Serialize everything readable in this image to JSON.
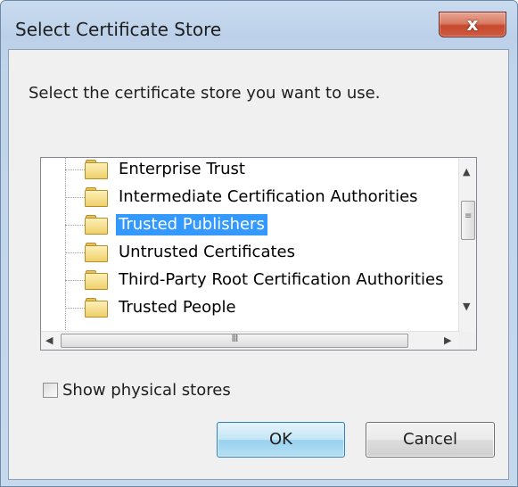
{
  "window": {
    "title": "Select Certificate Store",
    "close_glyph": "x"
  },
  "prompt": "Select the certificate store you want to use.",
  "tree": {
    "items": [
      {
        "label": "Enterprise Trust",
        "icon": "folder-icon",
        "selected": false
      },
      {
        "label": "Intermediate Certification Authorities",
        "icon": "folder-icon",
        "selected": false
      },
      {
        "label": "Trusted Publishers",
        "icon": "folder-icon",
        "selected": true
      },
      {
        "label": "Untrusted Certificates",
        "icon": "folder-icon",
        "selected": false
      },
      {
        "label": "Third-Party Root Certification Authorities",
        "icon": "folder-icon",
        "selected": false
      },
      {
        "label": "Trusted People",
        "icon": "folder-icon",
        "selected": false
      }
    ],
    "scroll_up_glyph": "▲",
    "scroll_down_glyph": "▼",
    "scroll_left_glyph": "◀",
    "scroll_right_glyph": "▶",
    "vthumb_grip": "≡",
    "hthumb_grip": "III"
  },
  "show_physical": {
    "label": "Show physical stores",
    "checked": false
  },
  "buttons": {
    "ok": "OK",
    "cancel": "Cancel"
  },
  "colors": {
    "selection": "#3399ff",
    "ok_border": "#3c7fb1",
    "close_red": "#c5492e"
  }
}
